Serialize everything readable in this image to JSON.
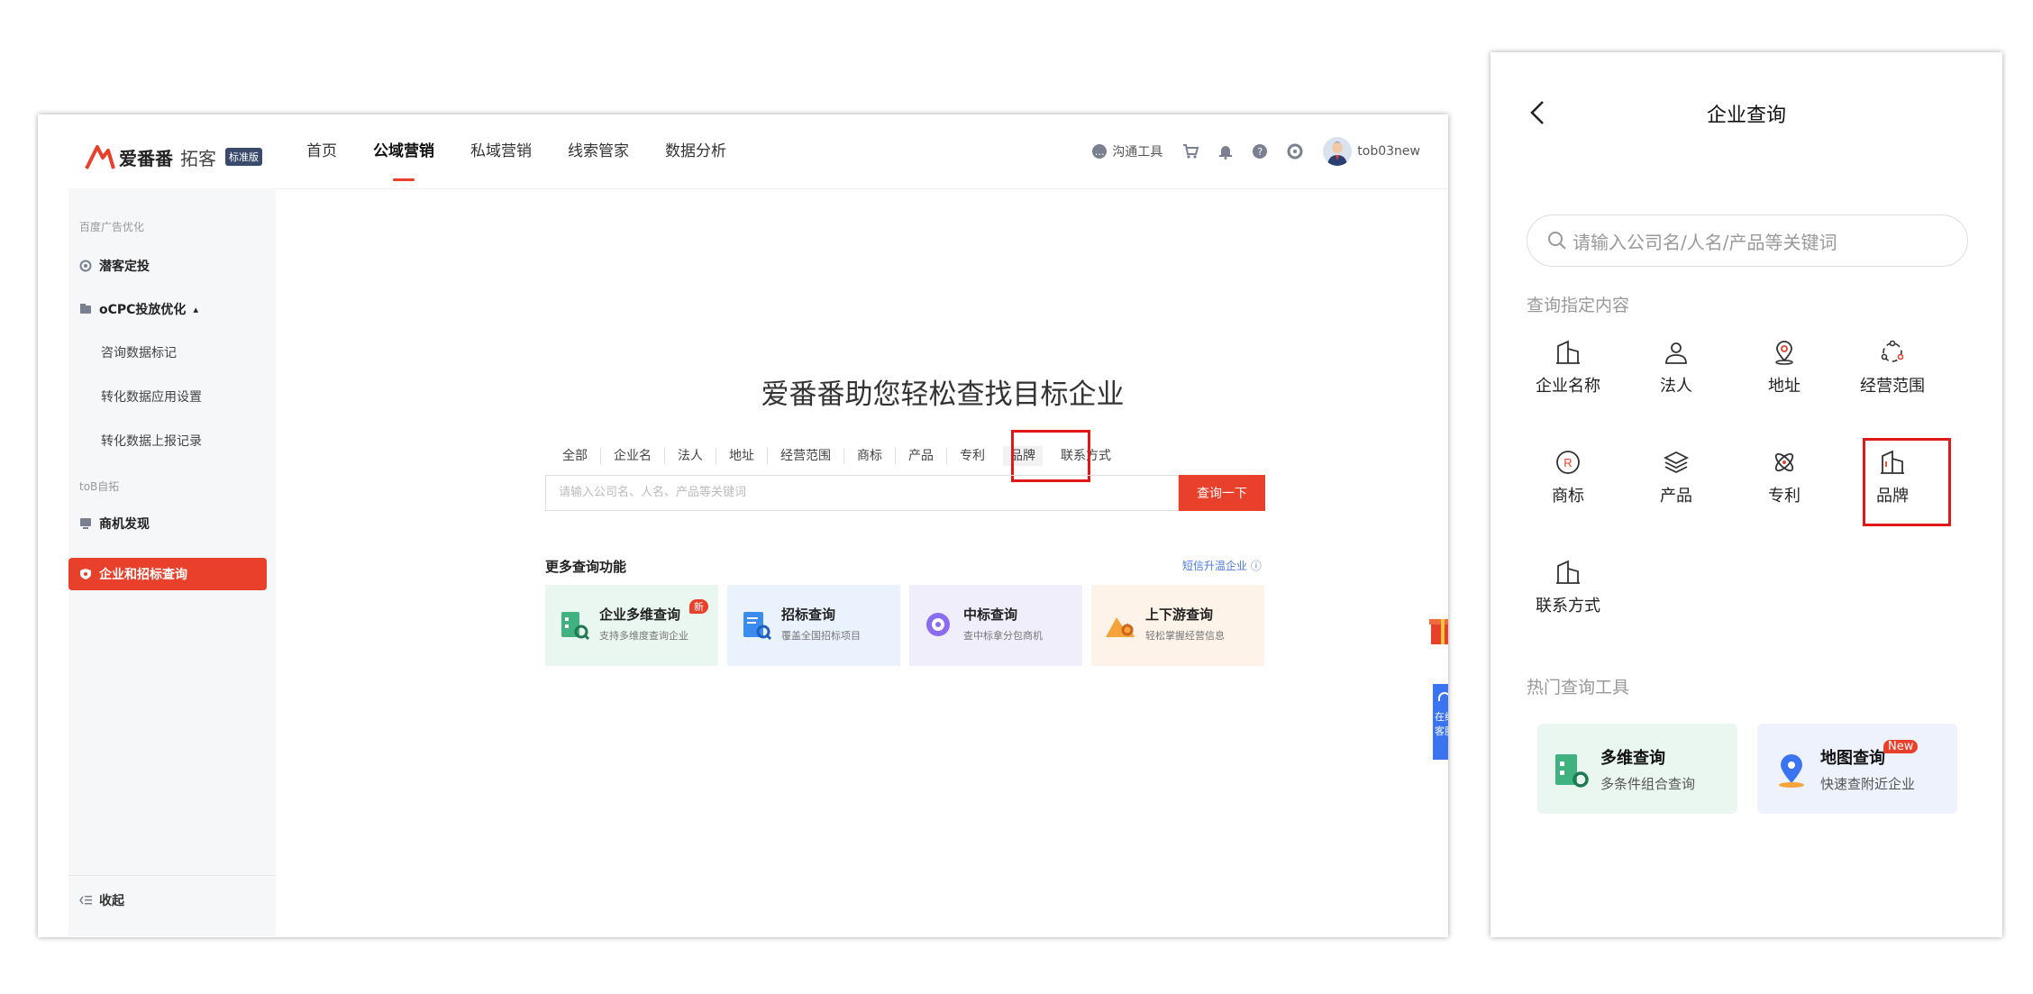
{
  "desktop": {
    "logo": {
      "name": "爱番番",
      "sub": "拓客",
      "badge": "标准版"
    },
    "nav": [
      {
        "label": "首页",
        "active": false
      },
      {
        "label": "公域营销",
        "active": true
      },
      {
        "label": "私域营销",
        "active": false
      },
      {
        "label": "线索管家",
        "active": false
      },
      {
        "label": "数据分析",
        "active": false
      }
    ],
    "tools": {
      "chat_label": "沟通工具",
      "username": "tob03new"
    },
    "sidebar": {
      "group1": "百度广告优化",
      "item_lead": "潜客定投",
      "item_ocpc": "oCPC投放优化",
      "ocpc_arrow": "▴",
      "sub1": "咨询数据标记",
      "sub2": "转化数据应用设置",
      "sub3": "转化数据上报记录",
      "group2": "toB自拓",
      "item_biz": "商机发现",
      "item_active": "企业和招标查询",
      "collapse": "收起"
    },
    "main": {
      "title": "爱番番助您轻松查找目标企业",
      "tabs": [
        "全部",
        "企业名",
        "法人",
        "地址",
        "经营范围",
        "商标",
        "产品",
        "专利",
        "品牌",
        "联系方式"
      ],
      "search_placeholder": "请输入公司名、人名、产品等关键词",
      "search_button": "查询一下",
      "more_title": "更多查询功能",
      "more_link": "短信升温企业 ⓘ",
      "cards": [
        {
          "title": "企业多维查询",
          "sub": "支持多维度查询企业",
          "badge": "新",
          "bg": "#eaf7f1"
        },
        {
          "title": "招标查询",
          "sub": "覆盖全国招标项目",
          "badge": "",
          "bg": "#eaf3fd"
        },
        {
          "title": "中标查询",
          "sub": "查中标拿分包商机",
          "badge": "",
          "bg": "#f1eefc"
        },
        {
          "title": "上下游查询",
          "sub": "轻松掌握经营信息",
          "badge": "",
          "bg": "#fdf3e9"
        }
      ],
      "float_service": "在线客服"
    }
  },
  "mobile": {
    "title": "企业查询",
    "search_placeholder": "请输入公司名/人名/产品等关键词",
    "section1": "查询指定内容",
    "grid": [
      {
        "label": "企业名称",
        "icon": "building-icon"
      },
      {
        "label": "法人",
        "icon": "person-icon"
      },
      {
        "label": "地址",
        "icon": "location-icon"
      },
      {
        "label": "经营范围",
        "icon": "scope-icon"
      },
      {
        "label": "商标",
        "icon": "trademark-icon"
      },
      {
        "label": "产品",
        "icon": "layers-icon"
      },
      {
        "label": "专利",
        "icon": "patent-icon"
      },
      {
        "label": "品牌",
        "icon": "brand-icon"
      },
      {
        "label": "联系方式",
        "icon": "building-icon"
      }
    ],
    "section2": "热门查询工具",
    "tools": [
      {
        "title": "多维查询",
        "sub": "多条件组合查询",
        "badge": "",
        "bg": "#eaf7f1"
      },
      {
        "title": "地图查询",
        "sub": "快速查附近企业",
        "badge": "New",
        "bg": "#eef2fc"
      }
    ]
  },
  "colors": {
    "accent": "#e8402a",
    "highlight_box": "#e01818",
    "link": "#4a7ae0"
  }
}
